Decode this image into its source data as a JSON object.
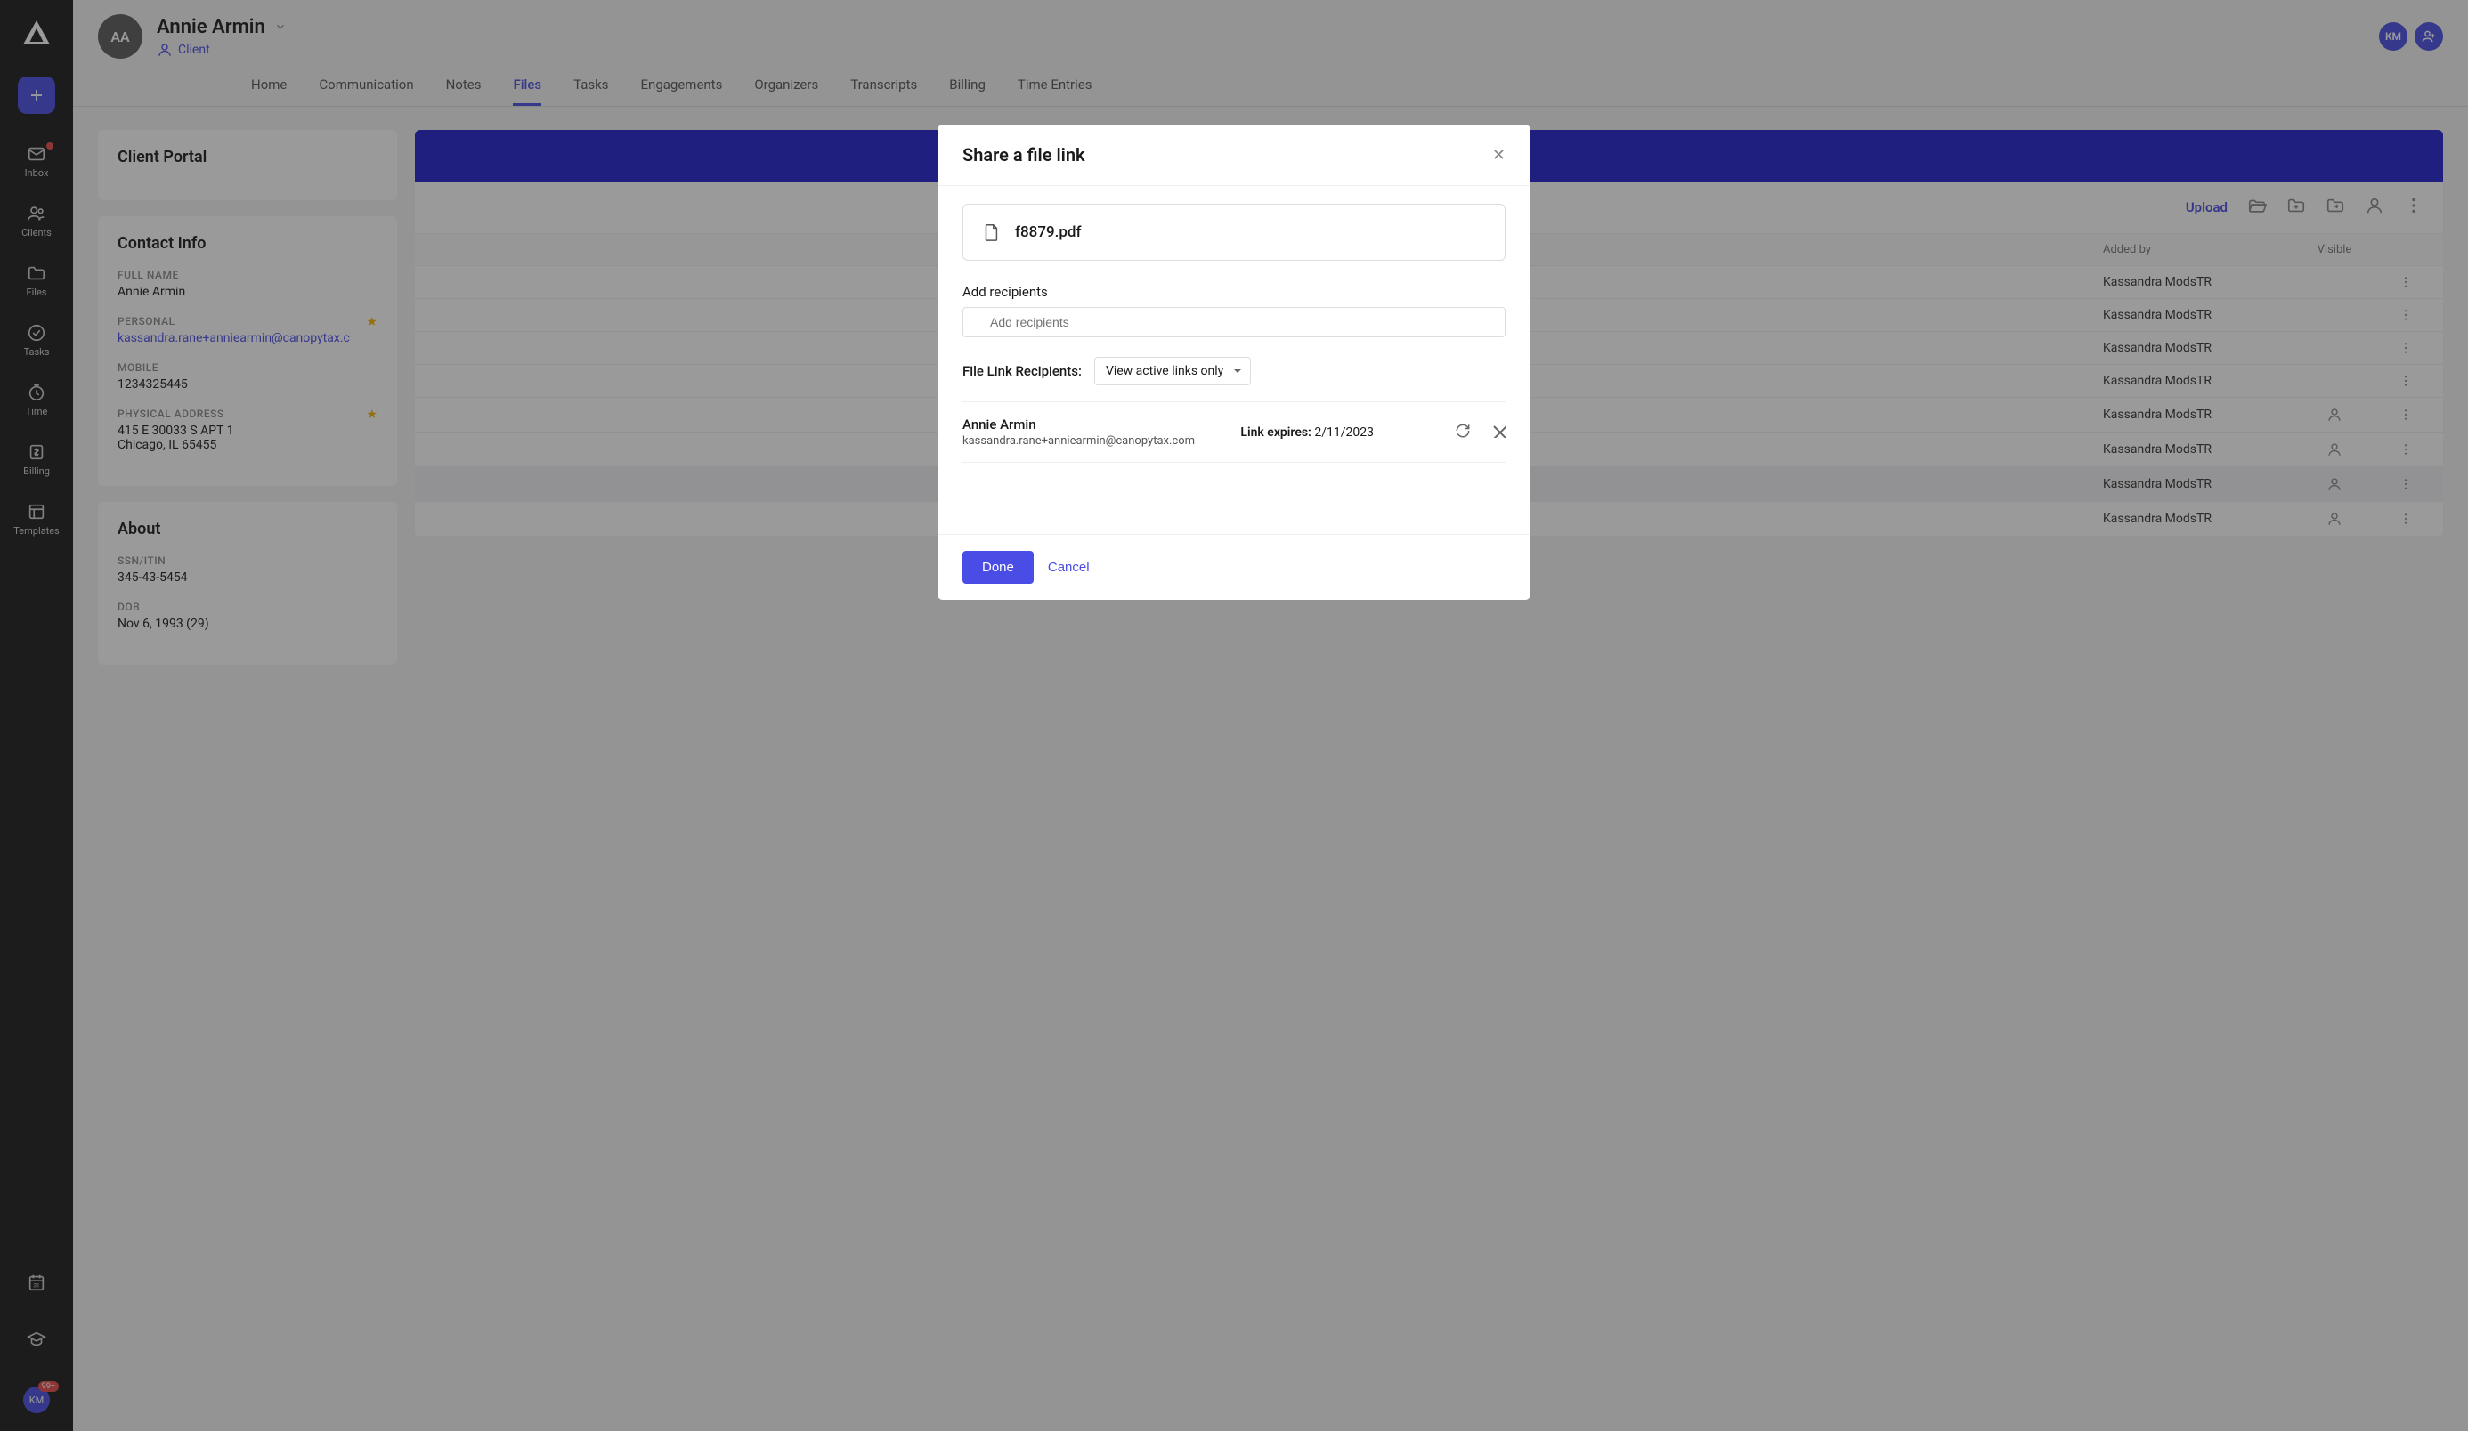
{
  "sidebar": {
    "nav": [
      {
        "label": "Inbox",
        "icon": "mail-icon",
        "dot": true
      },
      {
        "label": "Clients",
        "icon": "users-icon"
      },
      {
        "label": "Files",
        "icon": "folder-icon"
      },
      {
        "label": "Tasks",
        "icon": "check-circle-icon"
      },
      {
        "label": "Time",
        "icon": "clock-icon"
      },
      {
        "label": "Billing",
        "icon": "dollar-icon"
      },
      {
        "label": "Templates",
        "icon": "layout-icon"
      }
    ],
    "user_initials": "KM",
    "badge_count": "99+"
  },
  "header": {
    "avatar_initials": "AA",
    "name": "Annie Armin",
    "type_label": "Client",
    "right_initials": "KM"
  },
  "tabs": [
    "Home",
    "Communication",
    "Notes",
    "Files",
    "Tasks",
    "Engagements",
    "Organizers",
    "Transcripts",
    "Billing",
    "Time Entries"
  ],
  "active_tab": "Files",
  "portal_card_title": "Client Portal",
  "contact_card": {
    "title": "Contact Info",
    "full_name_label": "FULL NAME",
    "full_name": "Annie Armin",
    "personal_label": "PERSONAL",
    "personal_email": "kassandra.rane+anniearmin@canopytax.c",
    "mobile_label": "MOBILE",
    "mobile": "1234325445",
    "address_label": "PHYSICAL ADDRESS",
    "address_line1": "415 E 30033 S APT 1",
    "address_line2": "Chicago, IL 65455"
  },
  "about_card": {
    "title": "About",
    "ssn_label": "SSN/ITIN",
    "ssn": "345-43-5454",
    "dob_label": "DOB",
    "dob": "Nov 6, 1993 (29)"
  },
  "files_panel": {
    "upload_label": "Upload",
    "col_added": "Added by",
    "col_visible": "Visible",
    "rows": [
      {
        "added_by": "Kassandra ModsTR",
        "visible_icon": false
      },
      {
        "added_by": "Kassandra ModsTR",
        "visible_icon": false
      },
      {
        "added_by": "Kassandra ModsTR",
        "visible_icon": false
      },
      {
        "added_by": "Kassandra ModsTR",
        "visible_icon": false
      },
      {
        "added_by": "Kassandra ModsTR",
        "visible_icon": true
      },
      {
        "added_by": "Kassandra ModsTR",
        "visible_icon": true
      },
      {
        "added_by": "Kassandra ModsTR",
        "visible_icon": true,
        "highlighted": true
      },
      {
        "added_by": "Kassandra ModsTR",
        "visible_icon": true
      }
    ]
  },
  "modal": {
    "title": "Share a file link",
    "file_name": "f8879.pdf",
    "add_recipients_label": "Add recipients",
    "recipients_placeholder": "Add recipients",
    "filter_label": "File Link Recipients:",
    "filter_value": "View active links only",
    "recipient": {
      "name": "Annie Armin",
      "email": "kassandra.rane+anniearmin@canopytax.com",
      "expires_label": "Link expires:",
      "expires_date": "2/11/2023"
    },
    "done_label": "Done",
    "cancel_label": "Cancel"
  }
}
